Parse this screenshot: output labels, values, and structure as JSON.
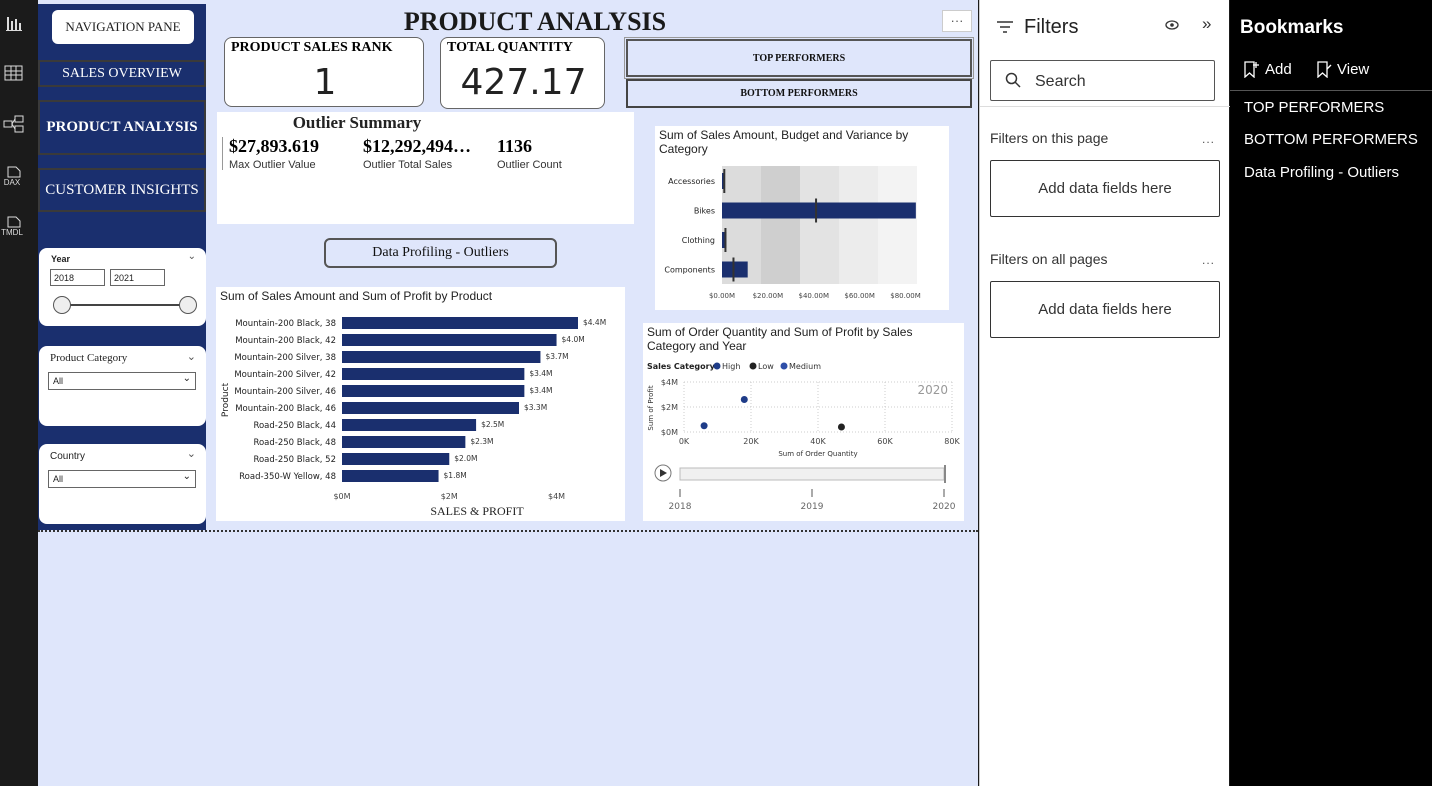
{
  "rail": {
    "icons": [
      "report-icon",
      "table-icon",
      "model-icon",
      "dax-icon",
      "tmdl-icon"
    ],
    "dax": "DAX",
    "tmdl": "TMDL"
  },
  "page": {
    "title": "PRODUCT ANALYSIS",
    "more": "···"
  },
  "nav": {
    "pane": "NAVIGATION PANE",
    "sales": "SALES OVERVIEW",
    "product": "PRODUCT ANALYSIS",
    "customer": "CUSTOMER INSIGHTS"
  },
  "year": {
    "label": "Year",
    "from": "2018",
    "to": "2021"
  },
  "category": {
    "label": "Product Category",
    "value": "All"
  },
  "country": {
    "label": "Country",
    "value": "All"
  },
  "kpi": {
    "rank_label": "PRODUCT SALES RANK",
    "rank_value": "1",
    "qty_label": "TOTAL QUANTITY",
    "qty_value": "427.17"
  },
  "buttons": {
    "top": "TOP PERFORMERS",
    "bottom": "BOTTOM PERFORMERS",
    "profiling": "Data Profiling - Outliers"
  },
  "outlier": {
    "title": "Outlier Summary",
    "v1": "$27,893.619",
    "l1": "Max Outlier Value",
    "v2": "$12,292,494…",
    "l2": "Outlier Total Sales",
    "v3": "1136",
    "l3": "Outlier Count"
  },
  "chart_data": [
    {
      "type": "bar",
      "title": "Sum of Sales Amount and Sum of Profit by Product",
      "xlabel": "SALES & PROFIT",
      "ylabel": "Product",
      "categories": [
        "Mountain-200 Black, 38",
        "Mountain-200 Black, 42",
        "Mountain-200 Silver, 38",
        "Mountain-200 Silver, 42",
        "Mountain-200 Silver, 46",
        "Mountain-200 Black, 46",
        "Road-250 Black, 44",
        "Road-250 Black, 48",
        "Road-250 Black, 52",
        "Road-350-W Yellow, 48"
      ],
      "values": [
        4.4,
        4.0,
        3.7,
        3.4,
        3.4,
        3.3,
        2.5,
        2.3,
        2.0,
        1.8
      ],
      "labels": [
        "$4.4M",
        "$4.0M",
        "$3.7M",
        "$3.4M",
        "$3.4M",
        "$3.3M",
        "$2.5M",
        "$2.3M",
        "$2.0M",
        "$1.8M"
      ],
      "xticks": [
        "$0M",
        "$2M",
        "$4M"
      ],
      "xlim": [
        0,
        5
      ],
      "color": "#1a2f6e"
    },
    {
      "type": "bar",
      "title": "Sum of Sales Amount, Budget and Variance by Category",
      "categories": [
        "Accessories",
        "Bikes",
        "Clothing",
        "Components"
      ],
      "values": [
        0.7,
        84.5,
        1.9,
        11.2
      ],
      "budget": [
        1,
        41,
        1.5,
        5
      ],
      "xticks": [
        "$0.00M",
        "$20.00M",
        "$40.00M",
        "$60.00M",
        "$80.00M"
      ],
      "xlim": [
        0,
        85
      ],
      "color": "#1a2f6e"
    },
    {
      "type": "scatter",
      "title": "Sum of Order Quantity and Sum of Profit by Sales Category and Year",
      "legend_title": "Sales Category",
      "xlabel": "Sum of Order Quantity",
      "ylabel": "Sum of Profit",
      "year": "2020",
      "series": [
        {
          "name": "High",
          "color": "#1f3c88",
          "points": [
            [
              6,
              0.5
            ],
            [
              18,
              2.6
            ]
          ]
        },
        {
          "name": "Low",
          "color": "#222222",
          "points": [
            [
              47,
              0.4
            ]
          ]
        },
        {
          "name": "Medium",
          "color": "#2e4ea8",
          "points": []
        }
      ],
      "xticks": [
        "0K",
        "20K",
        "40K",
        "60K",
        "80K"
      ],
      "yticks": [
        "$0M",
        "$2M",
        "$4M"
      ],
      "xlim": [
        0,
        80
      ],
      "ylim": [
        0,
        4
      ],
      "play": [
        "2018",
        "2019",
        "2020"
      ]
    }
  ],
  "filters": {
    "title": "Filters",
    "search": "Search",
    "this_page": "Filters on this page",
    "all_pages": "Filters on all pages",
    "add": "Add data fields here",
    "more": "...",
    "collapse": "»"
  },
  "bookmarks": {
    "title": "Bookmarks",
    "add": "Add",
    "view": "View",
    "items": [
      "TOP PERFORMERS",
      "BOTTOM PERFORMERS",
      "Data Profiling - Outliers"
    ]
  }
}
